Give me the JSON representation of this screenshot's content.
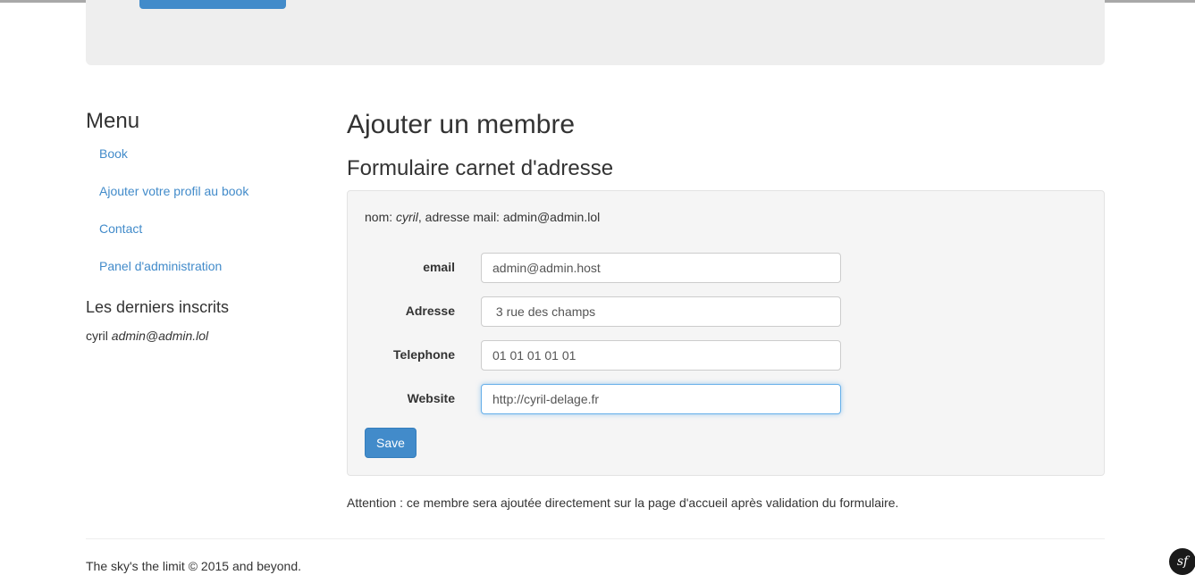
{
  "sidebar": {
    "title": "Menu",
    "items": [
      {
        "label": "Book"
      },
      {
        "label": "Ajouter votre profil au book"
      },
      {
        "label": "Contact"
      },
      {
        "label": "Panel d'administration"
      }
    ],
    "latest_title": "Les derniers inscrits",
    "latest_entry": {
      "name": "cyril",
      "email": "admin@admin.lol"
    }
  },
  "main": {
    "title": "Ajouter un membre",
    "subtitle": "Formulaire carnet d'adresse",
    "info": {
      "name_prefix": "nom: ",
      "name": "cyril",
      "email_prefix": ", adresse mail: ",
      "email": "admin@admin.lol"
    },
    "form": {
      "fields": [
        {
          "label": "email",
          "value": "admin@admin.host"
        },
        {
          "label": "Adresse",
          "value": " 3 rue des champs"
        },
        {
          "label": "Telephone",
          "value": "01 01 01 01 01"
        },
        {
          "label": "Website",
          "value": "http://cyril-delage.fr"
        }
      ],
      "save_label": "Save"
    },
    "note": "Attention : ce membre sera ajoutée directement sur la page d'accueil après validation du formulaire."
  },
  "footer": {
    "text": "The sky's the limit © 2015 and beyond."
  },
  "debug_badge": {
    "label": "sf",
    "icon": "symfony-icon"
  },
  "colors": {
    "link": "#428bca",
    "primary_button": "#428bca",
    "well_bg": "#f5f5f5",
    "jumbotron_bg": "#eeeeee",
    "focus_border": "#66afe9"
  }
}
